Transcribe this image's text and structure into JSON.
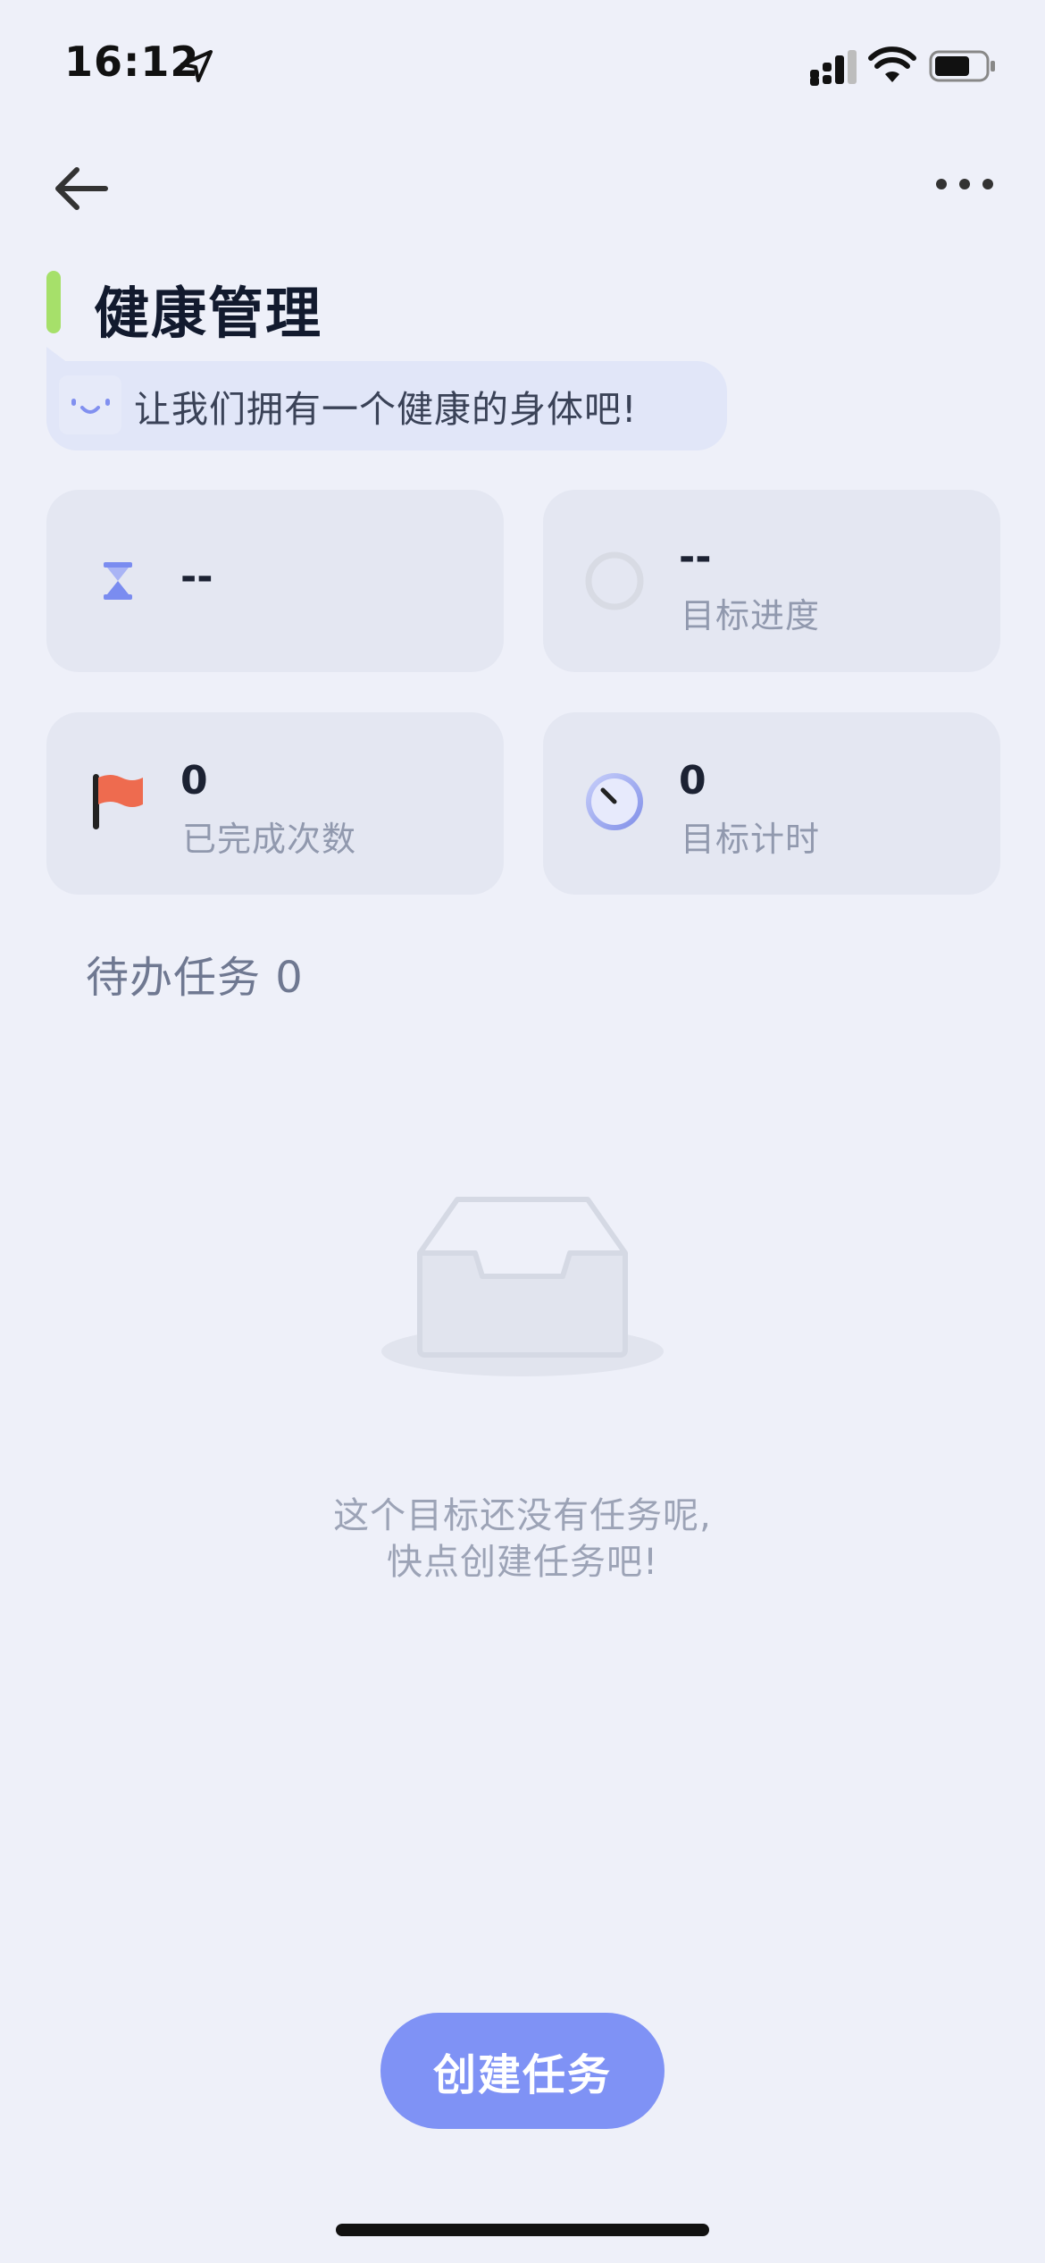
{
  "status_bar": {
    "time": "16:12"
  },
  "header": {
    "title": "健康管理",
    "accent_color": "#A6E06A"
  },
  "motto": {
    "text": "让我们拥有一个健康的身体吧!"
  },
  "stats": {
    "duration": {
      "value": "--",
      "icon": "hourglass-icon"
    },
    "progress": {
      "value": "--",
      "label": "目标进度",
      "icon": "progress-ring-icon"
    },
    "completed": {
      "value": "0",
      "label": "已完成次数",
      "icon": "flag-icon"
    },
    "timer": {
      "value": "0",
      "label": "目标计时",
      "icon": "clock-icon"
    }
  },
  "todo": {
    "title": "待办任务 0"
  },
  "empty_state": {
    "line1": "这个目标还没有任务呢,",
    "line2": "快点创建任务吧!",
    "icon": "empty-inbox-icon"
  },
  "actions": {
    "create_task_label": "创建任务",
    "button_color": "#7F92F5"
  }
}
